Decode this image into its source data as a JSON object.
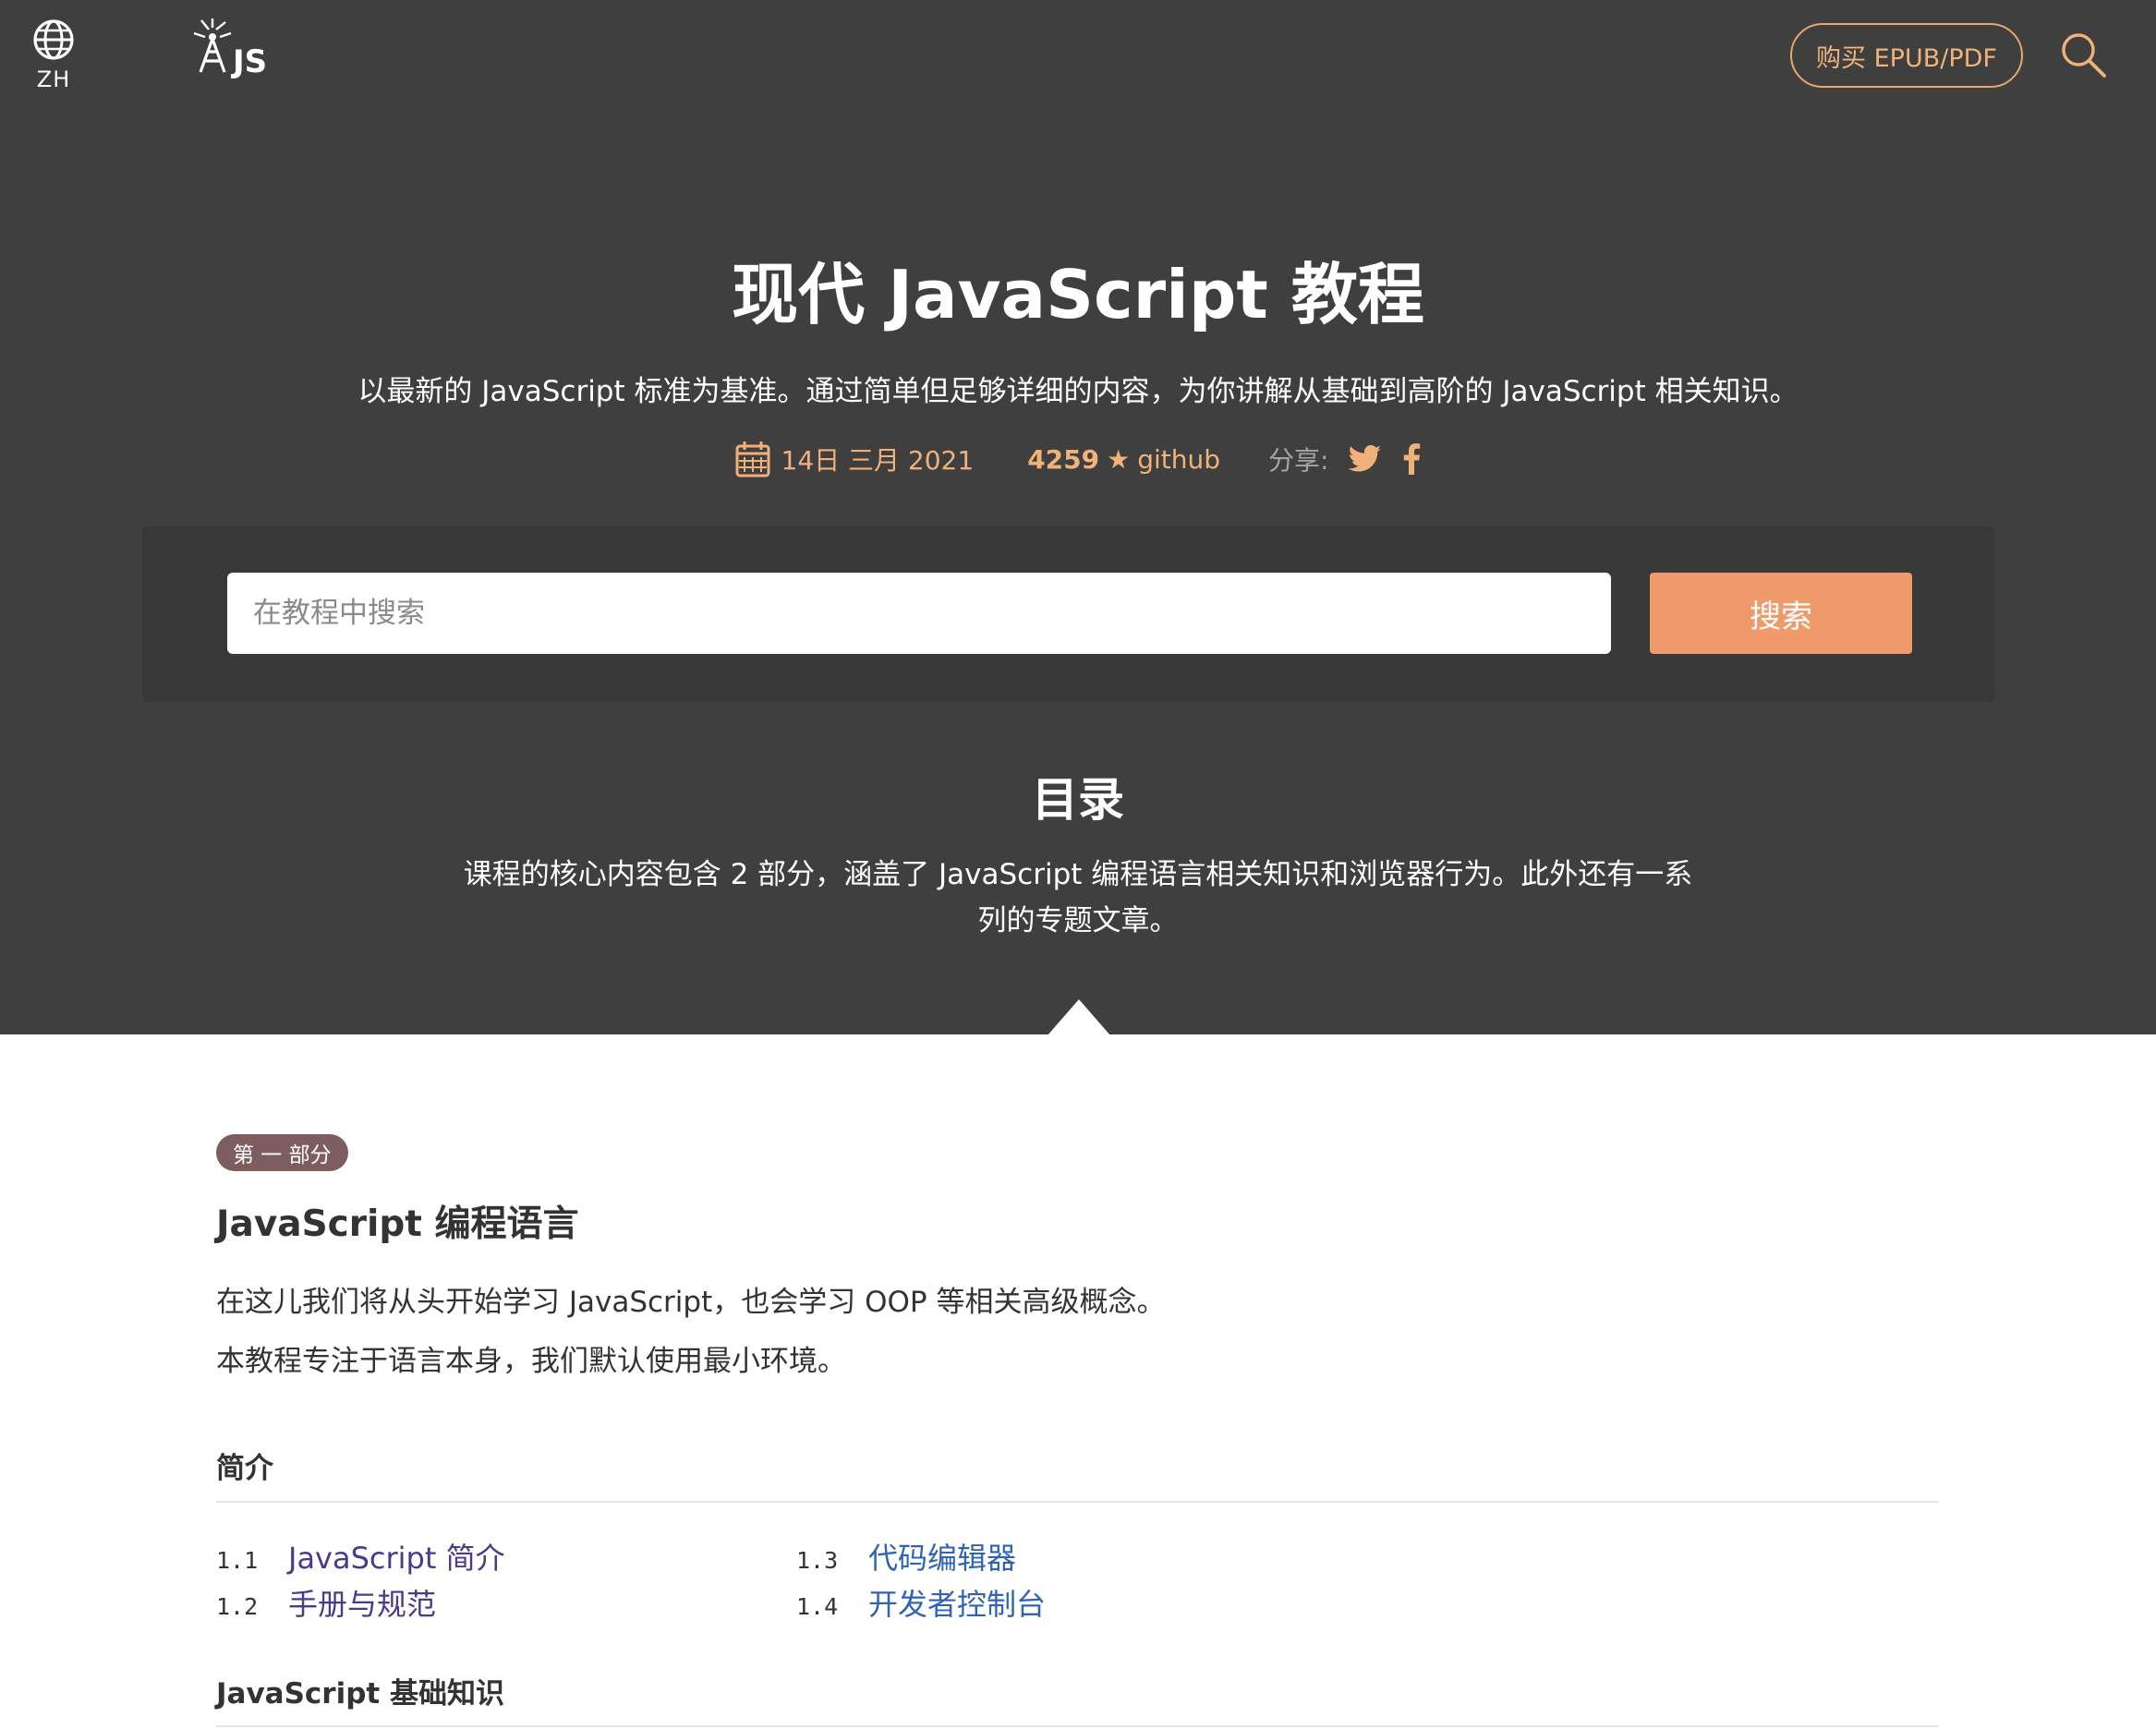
{
  "header": {
    "lang_code": "ZH",
    "logo_label": "JS",
    "buy_label": "购买 EPUB/PDF"
  },
  "hero": {
    "title": "现代 JavaScript 教程",
    "subtitle": "以最新的 JavaScript 标准为基准。通过简单但足够详细的内容，为你讲解从基础到高阶的 JavaScript 相关知识。",
    "date": "14日 三月 2021",
    "stars": "4259",
    "github_label": "github",
    "share_label": "分享:"
  },
  "search": {
    "placeholder": "在教程中搜索",
    "button_label": "搜索"
  },
  "toc": {
    "title": "目录",
    "description": "课程的核心内容包含 2 部分，涵盖了 JavaScript 编程语言相关知识和浏览器行为。此外还有一系列的专题文章。"
  },
  "part1": {
    "badge": "第 一 部分",
    "title": "JavaScript 编程语言",
    "text1": "在这儿我们将从头开始学习 JavaScript，也会学习 OOP 等相关高级概念。",
    "text2": "本教程专注于语言本身，我们默认使用最小环境。",
    "sections": [
      {
        "title": "简介",
        "items": [
          {
            "num": "1.1",
            "label": "JavaScript 简介"
          },
          {
            "num": "1.2",
            "label": "手册与规范"
          },
          {
            "num": "1.3",
            "label": "代码编辑器"
          },
          {
            "num": "1.4",
            "label": "开发者控制台"
          }
        ]
      },
      {
        "title": "JavaScript 基础知识",
        "items": []
      }
    ]
  },
  "colors": {
    "hero_bg": "#3f3f3f",
    "accent": "#f0b27a",
    "search_button": "#ef9a6a",
    "badge_bg": "#7d5d5d",
    "link_visited": "#4a3a8a",
    "link": "#2f63b5"
  },
  "icons": [
    "globe-icon",
    "js-logo",
    "search-icon",
    "calendar-icon",
    "star-icon",
    "twitter-icon",
    "facebook-icon"
  ]
}
